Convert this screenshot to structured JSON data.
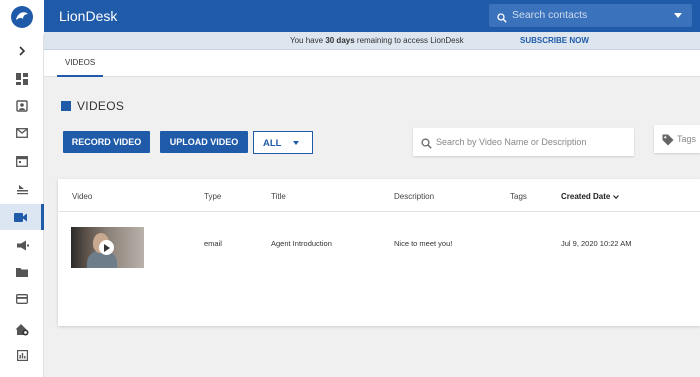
{
  "header": {
    "brand": "LionDesk",
    "search_placeholder": "Search contacts"
  },
  "notice": {
    "prefix": "You have",
    "days": "30 days",
    "suffix": "remaining to access LionDesk",
    "link": "SUBSCRIBE NOW"
  },
  "tabs": [
    {
      "label": "VIDEOS",
      "active": true
    }
  ],
  "main": {
    "title": "VIDEOS",
    "record_label": "RECORD VIDEO",
    "upload_label": "UPLOAD VIDEO",
    "filter_value": "ALL",
    "search_placeholder": "Search by Video Name or Description",
    "tags_placeholder": "Tags"
  },
  "table": {
    "columns": [
      "Video",
      "Type",
      "Title",
      "Description",
      "Tags",
      "Created Date"
    ],
    "sorted_column": "Created Date",
    "rows": [
      {
        "type": "email",
        "title": "Agent Introduction",
        "description": "Nice to meet you!",
        "tags": "",
        "created": "Jul 9, 2020 10:22 AM"
      }
    ]
  },
  "sidebar": {
    "icons": [
      "expand-icon",
      "dashboard-icon",
      "contacts-icon",
      "mail-icon",
      "calendar-icon",
      "campaigns-icon",
      "video-icon",
      "megaphone-icon",
      "folder-icon",
      "billing-icon",
      "home-search-icon",
      "reports-icon"
    ],
    "active": "video-icon"
  },
  "colors": {
    "primary": "#1f5ba8",
    "topbar": "#1f5ba8",
    "notice_bg": "#dde5ef",
    "page_bg": "#f0f0f0"
  }
}
